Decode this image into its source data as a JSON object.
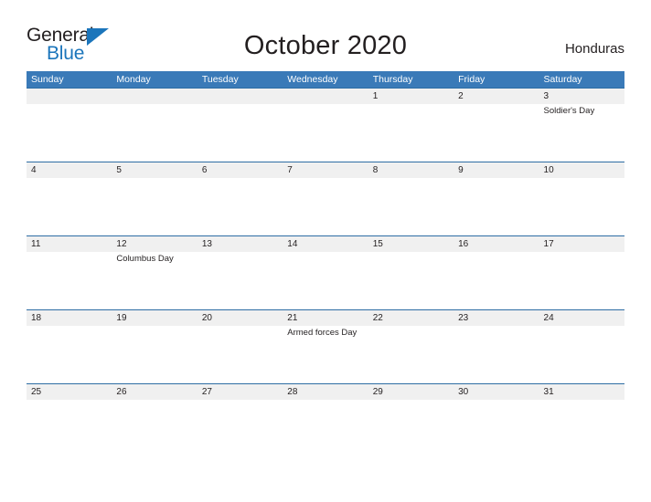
{
  "brand": {
    "line1": "General",
    "line2": "Blue",
    "triangle_icon": "blue-triangle-icon",
    "color_dark": "#231f20",
    "color_blue": "#1b75bb"
  },
  "header": {
    "title": "October 2020",
    "country": "Honduras"
  },
  "colors": {
    "header_blue": "#3a7ab8",
    "row_divider_blue": "#2e6da4",
    "date_band_gray": "#f0f0f0",
    "text": "#231f20"
  },
  "calendar": {
    "month": "October",
    "year": "2020",
    "day_headers": [
      "Sunday",
      "Monday",
      "Tuesday",
      "Wednesday",
      "Thursday",
      "Friday",
      "Saturday"
    ],
    "weeks": [
      {
        "dates": [
          "",
          "",
          "",
          "",
          "1",
          "2",
          "3"
        ],
        "events": [
          [],
          [],
          [],
          [],
          [],
          [],
          [
            "Soldier's Day"
          ]
        ]
      },
      {
        "dates": [
          "4",
          "5",
          "6",
          "7",
          "8",
          "9",
          "10"
        ],
        "events": [
          [],
          [],
          [],
          [],
          [],
          [],
          []
        ]
      },
      {
        "dates": [
          "11",
          "12",
          "13",
          "14",
          "15",
          "16",
          "17"
        ],
        "events": [
          [],
          [
            "Columbus Day"
          ],
          [],
          [],
          [],
          [],
          []
        ]
      },
      {
        "dates": [
          "18",
          "19",
          "20",
          "21",
          "22",
          "23",
          "24"
        ],
        "events": [
          [],
          [],
          [],
          [
            "Armed forces Day"
          ],
          [],
          [],
          []
        ]
      },
      {
        "dates": [
          "25",
          "26",
          "27",
          "28",
          "29",
          "30",
          "31"
        ],
        "events": [
          [],
          [],
          [],
          [],
          [],
          [],
          []
        ]
      }
    ]
  }
}
